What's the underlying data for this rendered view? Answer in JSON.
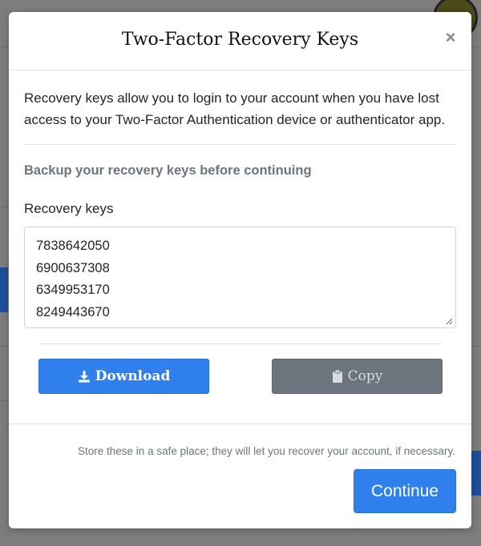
{
  "modal": {
    "title": "Two-Factor Recovery Keys",
    "close_glyph": "×",
    "intro": "Recovery keys allow you to login to your account when you have lost access to your Two-Factor Authentication device or authenticator app.",
    "backup_heading": "Backup your recovery keys before continuing",
    "keys_label": "Recovery keys",
    "keys": [
      "7838642050",
      "6900637308",
      "6349953170",
      "8249443670"
    ],
    "buttons": {
      "download_label": "Download",
      "download_icon": "download-icon",
      "copy_label": "Copy",
      "copy_icon": "clipboard-icon"
    },
    "footer_note": "Store these in a safe place; they will let you recover your account, if necessary.",
    "continue_label": "Continue"
  },
  "colors": {
    "primary": "#2f80ed",
    "secondary": "#6c757d",
    "overlay": "#7d7d7d"
  }
}
